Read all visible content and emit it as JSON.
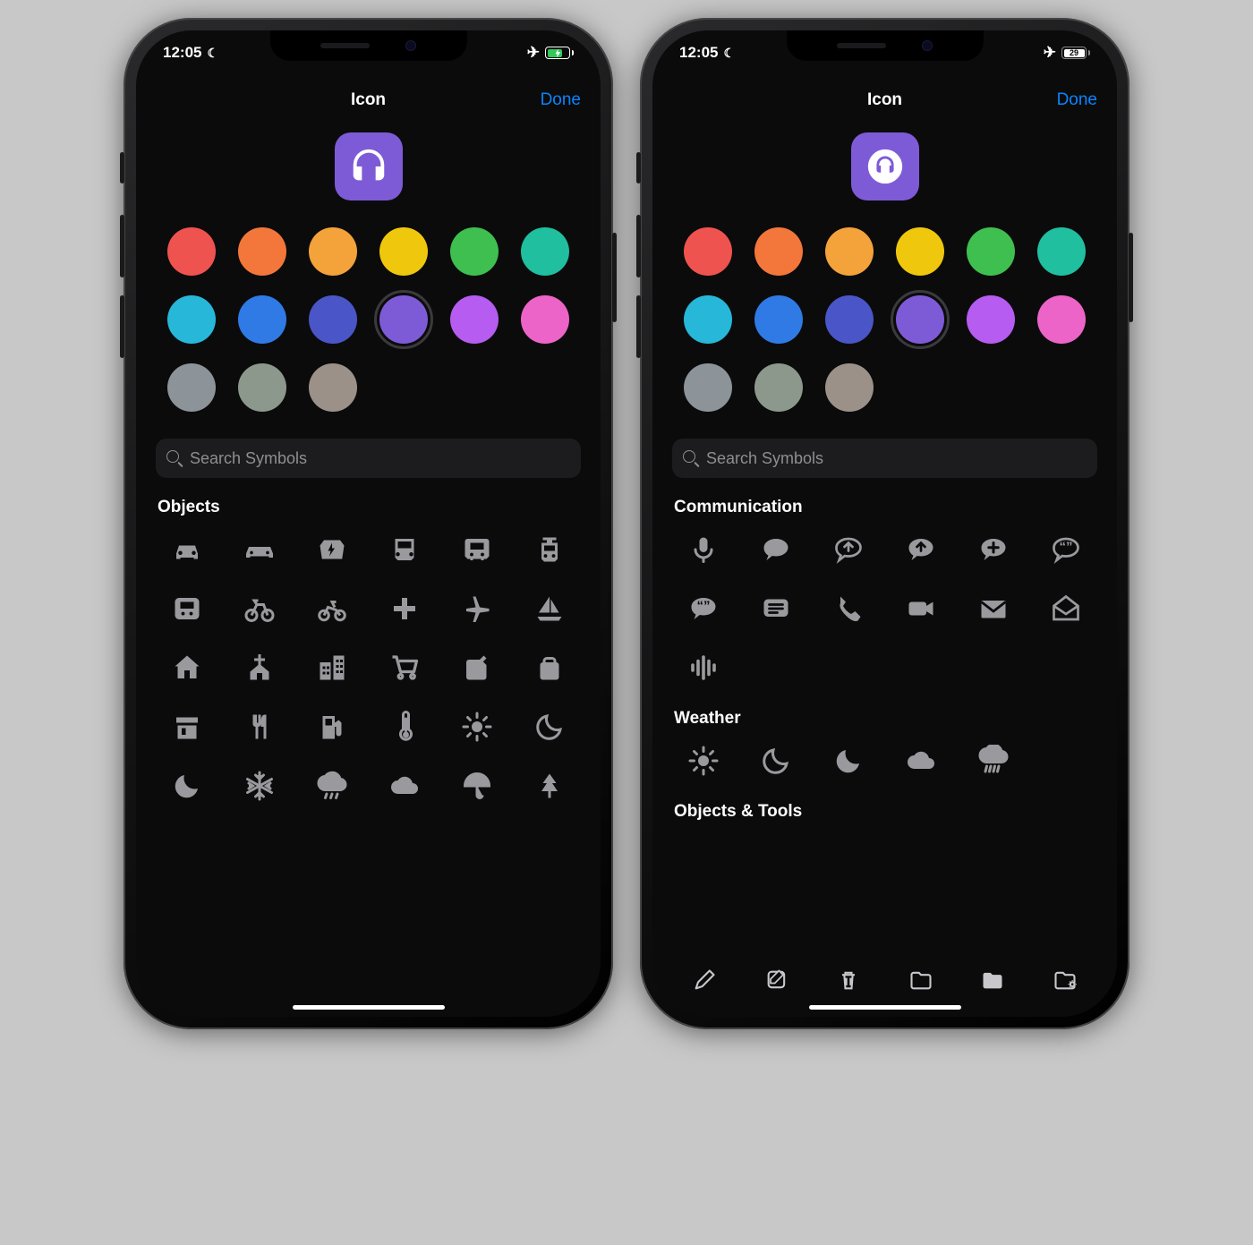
{
  "status": {
    "time": "12:05",
    "moon": "☾",
    "airplane": "✈",
    "battery_b_pct": "29"
  },
  "nav": {
    "title": "Icon",
    "done": "Done"
  },
  "preview": {
    "color": "#7e5bd6",
    "glyph": "headphones",
    "style_b": "circled"
  },
  "colors": [
    {
      "hex": "#ef534f",
      "sel": false
    },
    {
      "hex": "#f3763a",
      "sel": false
    },
    {
      "hex": "#f4a23a",
      "sel": false
    },
    {
      "hex": "#efc80e",
      "sel": false
    },
    {
      "hex": "#3fbf4f",
      "sel": false
    },
    {
      "hex": "#1fbf9f",
      "sel": false
    },
    {
      "hex": "#27b7d9",
      "sel": false
    },
    {
      "hex": "#2f7ae5",
      "sel": false
    },
    {
      "hex": "#4a55c7",
      "sel": false
    },
    {
      "hex": "#7e5bd6",
      "sel": true
    },
    {
      "hex": "#b65cf0",
      "sel": false
    },
    {
      "hex": "#ed64c9",
      "sel": false
    },
    {
      "hex": "#8c9399",
      "sel": false
    },
    {
      "hex": "#8c988c",
      "sel": false
    },
    {
      "hex": "#9b9188",
      "sel": false
    }
  ],
  "search": {
    "placeholder": "Search Symbols"
  },
  "left": {
    "sections": [
      {
        "title": "Objects",
        "icons": [
          "car",
          "car-wide",
          "car-charge",
          "bus",
          "bus-alt",
          "tram",
          "subway",
          "bicycle",
          "motorcycle",
          "plus",
          "airplane",
          "sailboat",
          "house",
          "church",
          "buildings",
          "cart",
          "fuelcan",
          "bag",
          "store",
          "cutlery",
          "fuelpump",
          "thermometer",
          "sun",
          "moon",
          "moon-fill",
          "snowflake",
          "cloud-rain",
          "cloud",
          "umbrella",
          "tree"
        ]
      }
    ]
  },
  "right": {
    "sections": [
      {
        "title": "Communication",
        "icons": [
          "mic",
          "bubble-fill",
          "bubble-up",
          "bubble-up-fill",
          "bubble-plus",
          "bubble-quote",
          "bubble-quote-fill",
          "message-lines",
          "phone",
          "video",
          "mail",
          "mail-open",
          "waveform"
        ]
      },
      {
        "title": "Weather",
        "icons": [
          "sun",
          "moon",
          "moon-fill",
          "cloud",
          "cloud-rain-heavy"
        ]
      },
      {
        "title": "Objects & Tools",
        "icons": []
      }
    ],
    "toolbar": [
      "pencil",
      "compose",
      "trash",
      "folder",
      "folder-fill",
      "folder-gear"
    ]
  }
}
